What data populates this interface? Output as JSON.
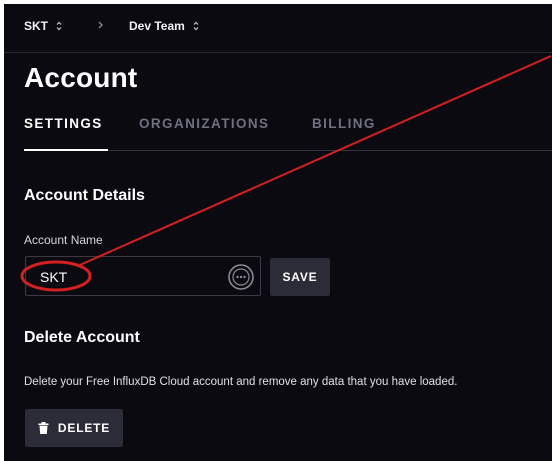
{
  "breadcrumb": {
    "org": "SKT",
    "bucket": "Dev Team"
  },
  "page": {
    "title": "Account"
  },
  "tabs": [
    {
      "label": "SETTINGS",
      "active": true
    },
    {
      "label": "ORGANIZATIONS",
      "active": false
    },
    {
      "label": "BILLING",
      "active": false
    }
  ],
  "account_details": {
    "heading": "Account Details",
    "name_label": "Account Name",
    "name_value": "SKT",
    "save_label": "SAVE"
  },
  "delete_account": {
    "heading": "Delete Account",
    "description": "Delete your Free InfluxDB Cloud account and remove any data that you have loaded.",
    "delete_label": "DELETE"
  },
  "colors": {
    "background": "#0b0a10",
    "button": "#2c2b38",
    "annotation": "#d42020"
  },
  "icons": {
    "org_switcher": "chevron-updown-icon",
    "separator": "chevron-right-icon",
    "input_action": "more-options-icon",
    "delete": "trash-icon"
  }
}
